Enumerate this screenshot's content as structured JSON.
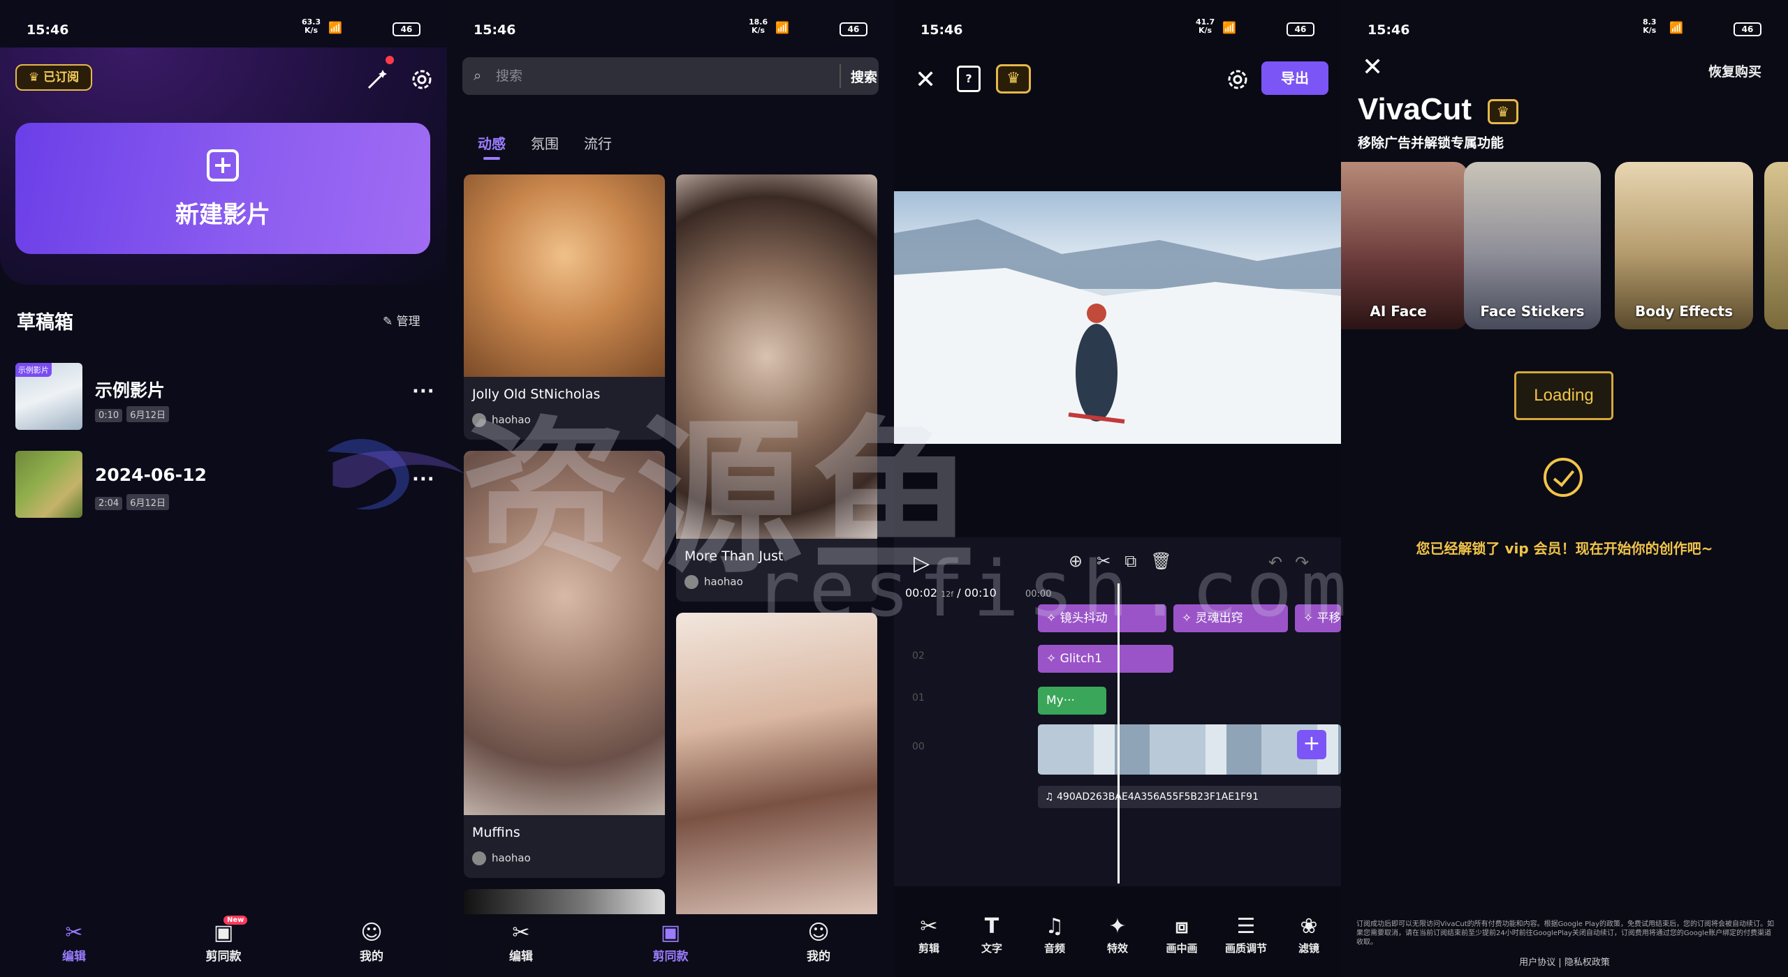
{
  "status": {
    "time": "15:46",
    "net_speeds": [
      "63.3\nK/s",
      "18.6\nK/s",
      "41.7\nK/s",
      "8.3\nK/s"
    ],
    "battery": "46"
  },
  "panel1": {
    "subscribed_badge": "已订阅",
    "new_film": "新建影片",
    "drafts_title": "草稿箱",
    "manage": "管理",
    "drafts": [
      {
        "tag": "示例影片",
        "name": "示例影片",
        "duration": "0:10",
        "date": "6月12日"
      },
      {
        "tag": "",
        "name": "2024-06-12",
        "duration": "2:04",
        "date": "6月12日"
      }
    ],
    "nav": [
      {
        "label": "编辑",
        "icon": "scissors-icon",
        "active": true
      },
      {
        "label": "剪同款",
        "icon": "template-icon",
        "badge": "New",
        "active": false
      },
      {
        "label": "我的",
        "icon": "user-icon",
        "active": false
      }
    ]
  },
  "panel2": {
    "search_placeholder": "搜索",
    "search_button": "搜索",
    "tabs": [
      "动感",
      "氛围",
      "流行"
    ],
    "cards": [
      {
        "title": "Jolly Old StNicholas",
        "author": "haohao"
      },
      {
        "title": "More Than Just",
        "author": "haohao"
      },
      {
        "title": "Muffins",
        "author": "haohao"
      }
    ],
    "nav": [
      {
        "label": "编辑",
        "active": false
      },
      {
        "label": "剪同款",
        "active": true
      },
      {
        "label": "我的",
        "active": false
      }
    ]
  },
  "panel3": {
    "export": "导出",
    "time_current": "00:02",
    "frame": "12f",
    "time_total": "/ 00:10",
    "ruler_start": "00:00",
    "fx_clips": [
      "镜头抖动",
      "灵魂出窍",
      "平移",
      "Glitch1"
    ],
    "text_clip": "My···",
    "track_labels": [
      "02",
      "01",
      "00"
    ],
    "audio_clip": "490AD263BAE4A356A55F5B23F1AE1F91",
    "tools": [
      {
        "label": "剪辑",
        "icon": "scissors-icon"
      },
      {
        "label": "文字",
        "icon": "text-icon"
      },
      {
        "label": "音频",
        "icon": "music-icon"
      },
      {
        "label": "特效",
        "icon": "effects-icon"
      },
      {
        "label": "画中画",
        "icon": "pip-icon"
      },
      {
        "label": "画质调节",
        "icon": "adjust-icon"
      },
      {
        "label": "滤镜",
        "icon": "filter-icon"
      }
    ]
  },
  "panel4": {
    "restore": "恢复购买",
    "brand": "VivaCut",
    "subtitle": "移除广告并解锁专属功能",
    "features": [
      "AI Face",
      "Face Stickers",
      "Body Effects"
    ],
    "loading": "Loading",
    "unlock_message": "您已经解锁了 vip 会员！现在开始你的创作吧~",
    "terms": "订阅成功后即可以无限访问VivaCut的所有付费功能和内容。根据Google Play的政策，免费试用结束后，您的订阅将会被自动续订。如果您需要取消，请在当前订阅结束前至少提前24小时前往GooglePlay关闭自动续订，订阅费用将通过您的Google账户绑定的付费渠道收取。",
    "links": "用户协议 | 隐私权政策"
  },
  "watermark": {
    "big": "资源鱼",
    "small": "resfish.com"
  },
  "colors": {
    "accent": "#7b55f5",
    "gold": "#f2c549",
    "background": "#0b0b1a"
  }
}
